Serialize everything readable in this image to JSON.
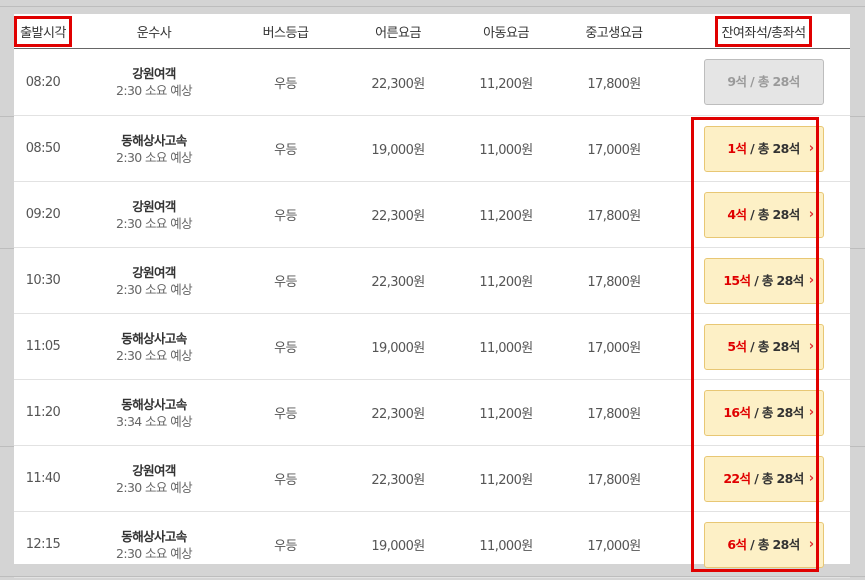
{
  "headers": {
    "departure_time": "출발시각",
    "carrier": "운수사",
    "bus_class": "버스등급",
    "adult_fare": "어른요금",
    "child_fare": "아동요금",
    "student_fare": "중고생요금",
    "seats": "잔여좌석/총좌석"
  },
  "rows": [
    {
      "time": "08:20",
      "carrier": "강원여객",
      "duration": "2:30 소요 예상",
      "class": "우등",
      "adult": "22,300원",
      "child": "11,200원",
      "student": "17,800원",
      "remain": "9석",
      "total": " / 총 28석",
      "available": false
    },
    {
      "time": "08:50",
      "carrier": "동해상사고속",
      "duration": "2:30 소요 예상",
      "class": "우등",
      "adult": "19,000원",
      "child": "11,000원",
      "student": "17,000원",
      "remain": "1석",
      "total": " / 총 28석",
      "available": true
    },
    {
      "time": "09:20",
      "carrier": "강원여객",
      "duration": "2:30 소요 예상",
      "class": "우등",
      "adult": "22,300원",
      "child": "11,200원",
      "student": "17,800원",
      "remain": "4석",
      "total": " / 총 28석",
      "available": true
    },
    {
      "time": "10:30",
      "carrier": "강원여객",
      "duration": "2:30 소요 예상",
      "class": "우등",
      "adult": "22,300원",
      "child": "11,200원",
      "student": "17,800원",
      "remain": "15석",
      "total": " / 총 28석",
      "available": true
    },
    {
      "time": "11:05",
      "carrier": "동해상사고속",
      "duration": "2:30 소요 예상",
      "class": "우등",
      "adult": "19,000원",
      "child": "11,000원",
      "student": "17,000원",
      "remain": "5석",
      "total": " / 총 28석",
      "available": true
    },
    {
      "time": "11:20",
      "carrier": "동해상사고속",
      "duration": "3:34 소요 예상",
      "class": "우등",
      "adult": "22,300원",
      "child": "11,200원",
      "student": "17,800원",
      "remain": "16석",
      "total": " / 총 28석",
      "available": true
    },
    {
      "time": "11:40",
      "carrier": "강원여객",
      "duration": "2:30 소요 예상",
      "class": "우등",
      "adult": "22,300원",
      "child": "11,200원",
      "student": "17,800원",
      "remain": "22석",
      "total": " / 총 28석",
      "available": true
    },
    {
      "time": "12:15",
      "carrier": "동해상사고속",
      "duration": "2:30 소요 예상",
      "class": "우등",
      "adult": "19,000원",
      "child": "11,000원",
      "student": "17,000원",
      "remain": "6석",
      "total": " / 총 28석",
      "available": true
    }
  ],
  "colors": {
    "highlight": "#e00000",
    "seat_button_bg": "#fdf0c6",
    "disabled_button_bg": "#e5e5e5"
  }
}
